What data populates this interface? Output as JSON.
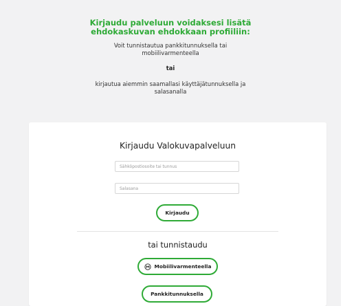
{
  "intro": {
    "title": "Kirjaudu palveluun voidaksesi lisätä ehdokaskuvan ehdokkaan profiiliin:",
    "auth_text": "Voit tunnistautua pankkitunnuksella tai mobiilivarmenteella",
    "or_text": "tai",
    "login_text": "kirjautua aiemmin saamallasi käyttäjätunnuksella ja salasanalla"
  },
  "login_card": {
    "title": "Kirjaudu Valokuvapalveluun",
    "email_placeholder": "Sähköpostiosoite tai tunnus",
    "password_placeholder": "Salasana",
    "login_button": "Kirjaudu",
    "alt_title": "tai tunnistaudu",
    "mobile_button": "Mobiilivarmenteella",
    "bank_button": "Pankkitunnuksella"
  },
  "colors": {
    "accent": "#2eaa36",
    "background": "#f2f2f3",
    "card": "#ffffff"
  },
  "icons": {
    "mobile_button_icon": "mobile-certificate-icon"
  }
}
